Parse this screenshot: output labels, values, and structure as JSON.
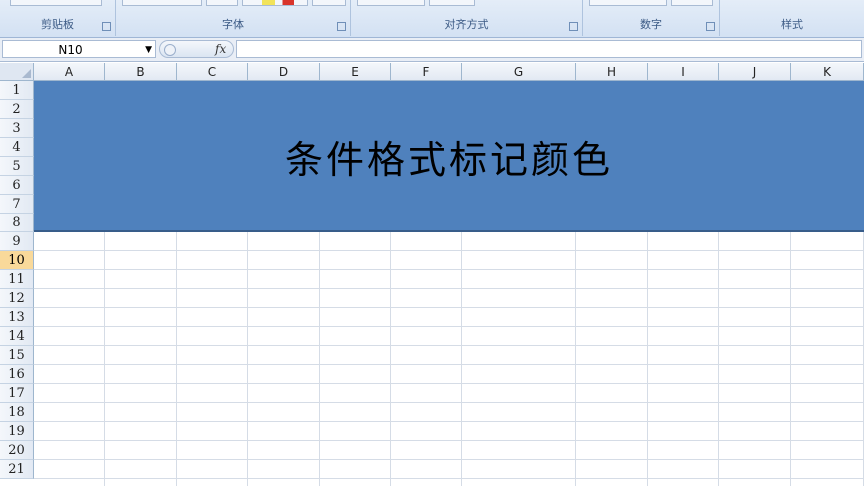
{
  "ribbon": {
    "groups": [
      {
        "label": "剪贴板"
      },
      {
        "label": "字体"
      },
      {
        "label": "对齐方式"
      },
      {
        "label": "数字"
      },
      {
        "label": "样式"
      }
    ]
  },
  "formula_bar": {
    "name_box": "N10",
    "fx": "fx",
    "formula": ""
  },
  "sheet": {
    "columns": [
      "A",
      "B",
      "C",
      "D",
      "E",
      "F",
      "G",
      "H",
      "I",
      "J",
      "K"
    ],
    "rows": [
      "1",
      "2",
      "3",
      "4",
      "5",
      "6",
      "7",
      "8",
      "9",
      "10",
      "11",
      "12",
      "13",
      "14",
      "15",
      "16",
      "17",
      "18",
      "19",
      "20",
      "21"
    ],
    "active_row": "10",
    "merged_title": "条件格式标记颜色"
  },
  "colors": {
    "ribbon_bg": "#dbe5f2",
    "header_bg": "#e2e9f3",
    "banner_fill": "#4f81bd",
    "active_header": "#f9d99a"
  }
}
